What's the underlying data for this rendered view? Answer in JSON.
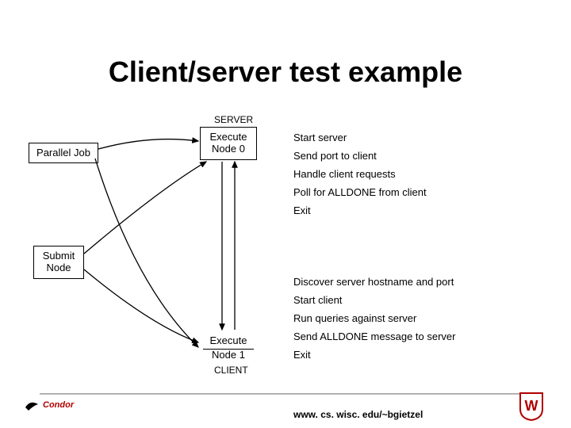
{
  "title": "Client/server test example",
  "labels": {
    "server": "SERVER",
    "client": "CLIENT"
  },
  "nodes": {
    "parallel_job": "Parallel Job",
    "execute_node0_line1": "Execute",
    "execute_node0_line2": "Node 0",
    "submit_node_line1": "Submit",
    "submit_node_line2": "Node",
    "execute_node1_line1": "Execute",
    "execute_node1_line2": "Node 1"
  },
  "server_steps": [
    "Start server",
    "Send port to client",
    "Handle client requests",
    "Poll for ALLDONE from client",
    "Exit"
  ],
  "client_steps": [
    "Discover server hostname and port",
    "Start client",
    "Run queries against server",
    "Send ALLDONE message to server",
    "Exit"
  ],
  "footer": {
    "url": "www. cs. wisc. edu/~bgietzel",
    "condor": "Condor",
    "wisc_alt": "W"
  }
}
